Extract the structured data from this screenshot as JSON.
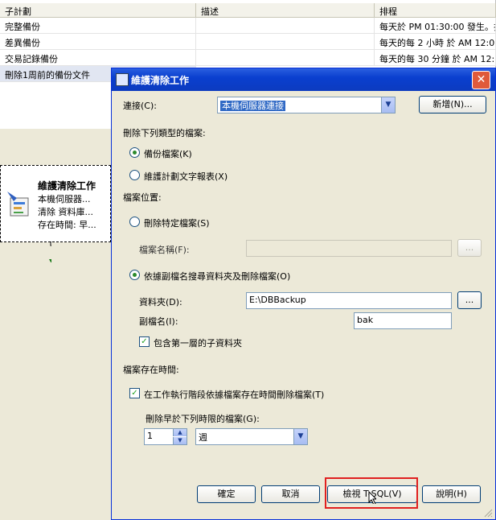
{
  "grid": {
    "headers": [
      "子計劃",
      "描述",
      "排程"
    ],
    "rows": [
      {
        "name": "完整備份",
        "desc": "",
        "schedule": "每天於 PM 01:30:00 發生。排"
      },
      {
        "name": "差異備份",
        "desc": "",
        "schedule": "每天的每 2 小時 於 AM 12:0"
      },
      {
        "name": "交易記錄備份",
        "desc": "",
        "schedule": "每天的每 30 分鐘 於 AM 12:0"
      },
      {
        "name": "刪除1周前的備份文件",
        "desc": "",
        "schedule": ""
      }
    ]
  },
  "task": {
    "title": "維護清除工作",
    "line1": "本機伺服器...",
    "line2": "清除 資料庫...",
    "line3": "存在時間: 早..."
  },
  "dialog": {
    "title": "維護清除工作",
    "close_label": "✕",
    "connection_label": "連接(C):",
    "connection_value": "本機伺服器連接",
    "new_label": "新增(N)...",
    "delete_type_label": "刪除下列類型的檔案:",
    "radio_backup": "備份檔案(K)",
    "radio_report": "維護計劃文字報表(X)",
    "location_label": "檔案位置:",
    "radio_specific": "刪除特定檔案(S)",
    "filename_label": "檔案名稱(F):",
    "filename_value": "",
    "browse_label": "...",
    "radio_search": "依據副檔名搜尋資料夾及刪除檔案(O)",
    "folder_label": "資料夾(D):",
    "folder_value": "E:\\DBBackup",
    "ext_label": "副檔名(I):",
    "ext_value": "bak",
    "subfolder_label": "包含第一層的子資料夾",
    "age_section_label": "檔案存在時間:",
    "age_check_label": "在工作執行階段依據檔案存在時間刪除檔案(T)",
    "older_than_label": "刪除早於下列時限的檔案(G):",
    "age_number": "1",
    "age_unit": "週",
    "ok_label": "確定",
    "cancel_label": "取消",
    "tsql_label": "檢視 T-SQL(V)",
    "help_label": "說明(H)"
  },
  "colors": {
    "highlight": "#e02020",
    "titlebar": "#0a3fcf"
  }
}
